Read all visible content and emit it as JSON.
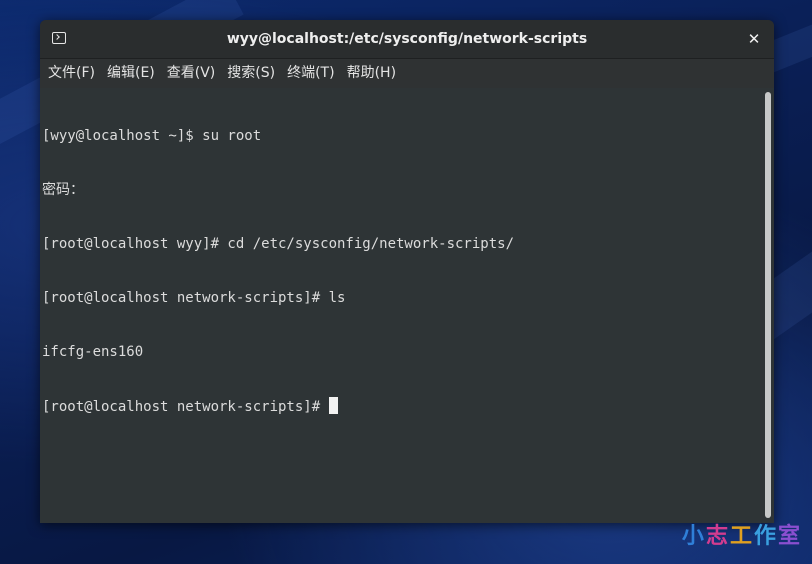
{
  "window": {
    "title": "wyy@localhost:/etc/sysconfig/network-scripts",
    "close_glyph": "✕",
    "icon": "terminal-icon"
  },
  "menu": [
    {
      "label": "文件(F)"
    },
    {
      "label": "编辑(E)"
    },
    {
      "label": "查看(V)"
    },
    {
      "label": "搜索(S)"
    },
    {
      "label": "终端(T)"
    },
    {
      "label": "帮助(H)"
    }
  ],
  "terminal": {
    "lines": [
      "[wyy@localhost ~]$ su root",
      "密码：",
      "[root@localhost wyy]# cd /etc/sysconfig/network-scripts/",
      "[root@localhost network-scripts]# ls",
      "ifcfg-ens160",
      "[root@localhost network-scripts]# "
    ]
  },
  "watermark": {
    "chars": [
      "小",
      "志",
      "工",
      "作",
      "室"
    ],
    "colors": [
      "#2f7fd8",
      "#d23c8f",
      "#e0a020",
      "#3aa0e0",
      "#8a4fd0"
    ]
  }
}
